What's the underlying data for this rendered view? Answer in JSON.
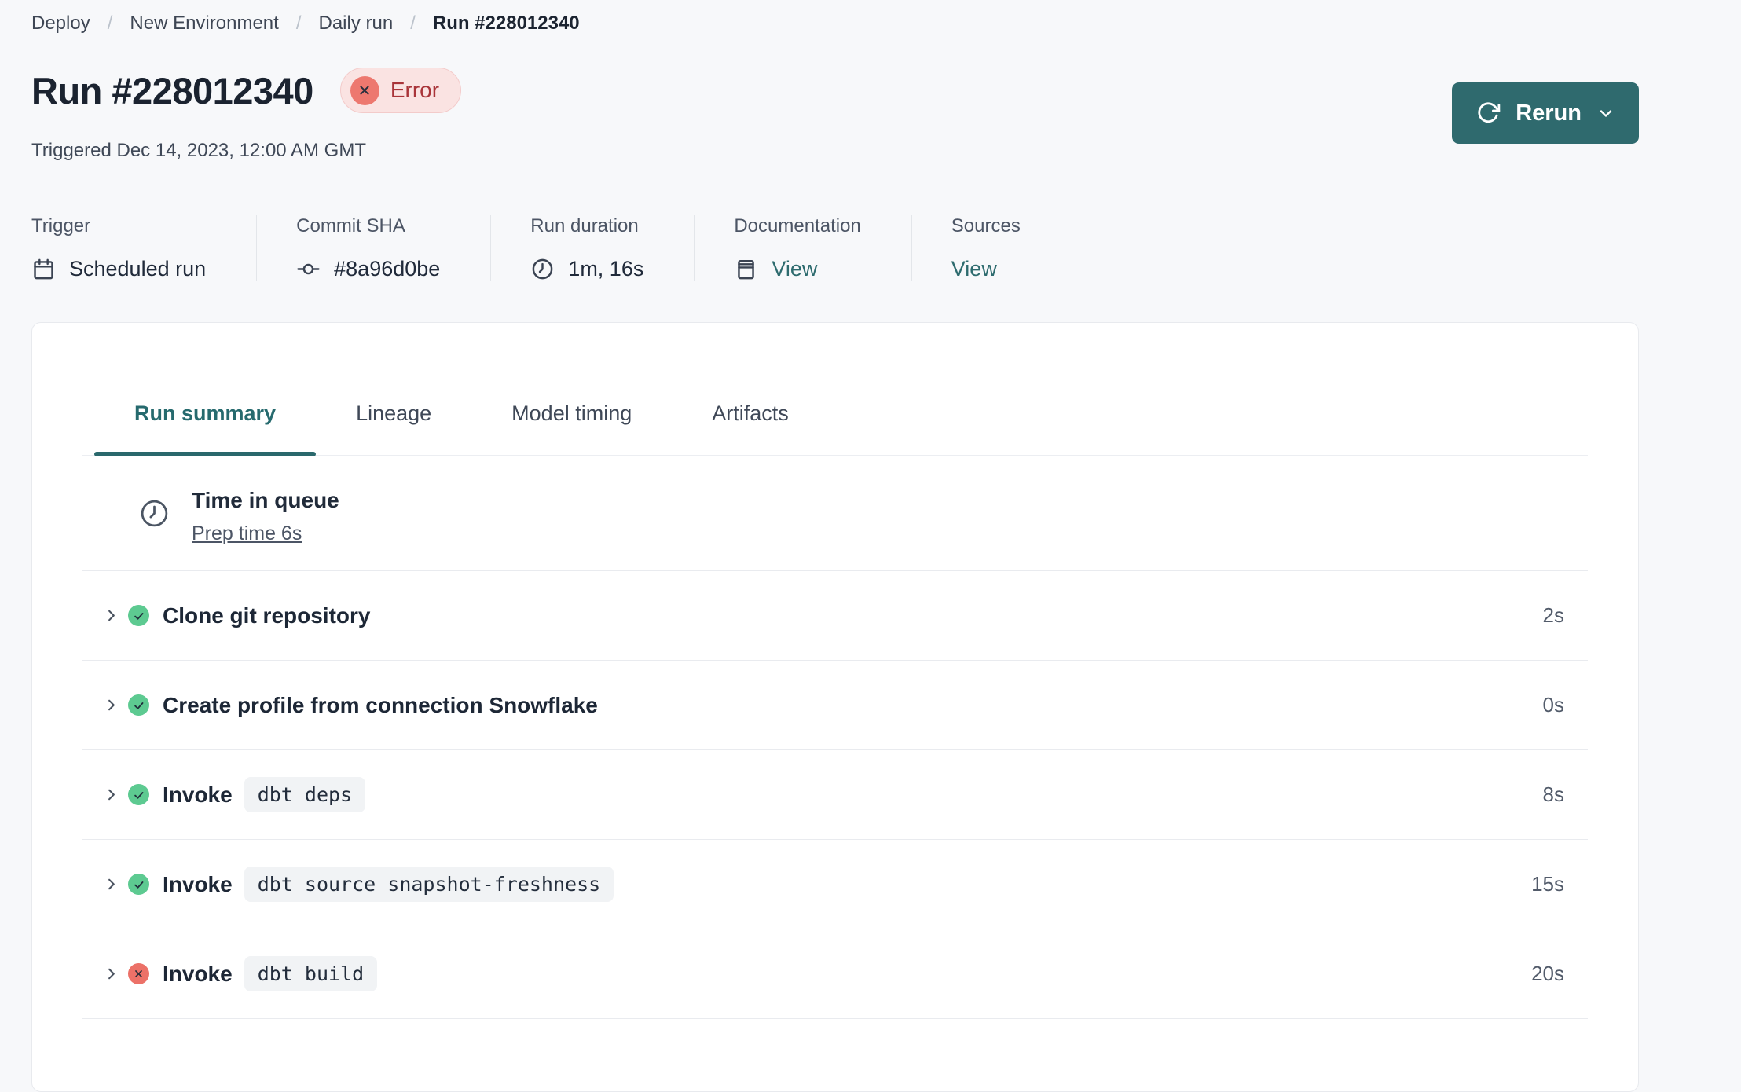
{
  "breadcrumb": {
    "separator": "/",
    "items": [
      {
        "label": "Deploy"
      },
      {
        "label": "New Environment"
      },
      {
        "label": "Daily run"
      },
      {
        "label": "Run #228012340"
      }
    ]
  },
  "header": {
    "title": "Run #228012340",
    "status_label": "Error",
    "status_icon": "x-circle-icon",
    "triggered": "Triggered Dec 14, 2023, 12:00 AM GMT",
    "rerun_label": "Rerun"
  },
  "meta": {
    "items": [
      {
        "label": "Trigger",
        "value": "Scheduled run",
        "icon": "calendar-icon"
      },
      {
        "label": "Commit SHA",
        "value": "#8a96d0be",
        "icon": "commit-icon"
      },
      {
        "label": "Run duration",
        "value": "1m, 16s",
        "icon": "clock-icon"
      },
      {
        "label": "Documentation",
        "value": "View",
        "icon": "book-icon",
        "link": true
      },
      {
        "label": "Sources",
        "value": "View",
        "link": true
      }
    ]
  },
  "tabs": [
    {
      "label": "Run summary",
      "active": true
    },
    {
      "label": "Lineage",
      "active": false
    },
    {
      "label": "Model timing",
      "active": false
    },
    {
      "label": "Artifacts",
      "active": false
    }
  ],
  "queue": {
    "title": "Time in queue",
    "link_label": "Prep time 6s",
    "icon": "clock-icon"
  },
  "steps": [
    {
      "label": "Clone git repository",
      "status": "success",
      "duration": "2s"
    },
    {
      "label": "Create profile from connection Snowflake",
      "status": "success",
      "duration": "0s"
    },
    {
      "label": "Invoke",
      "command": "dbt deps",
      "status": "success",
      "duration": "8s"
    },
    {
      "label": "Invoke",
      "command": "dbt source snapshot-freshness",
      "status": "success",
      "duration": "15s"
    },
    {
      "label": "Invoke",
      "command": "dbt build",
      "status": "error",
      "duration": "20s"
    }
  ],
  "colors": {
    "accent_teal": "#2F6A6E",
    "success_green": "#5DCA91",
    "error_red": "#EC7168",
    "error_badge_bg": "#FAE3E2",
    "error_badge_text": "#A93439",
    "page_bg": "#F7F8FA",
    "card_bg": "#FFFFFF",
    "text_dark": "#1C2431",
    "text_gray": "#4C5565",
    "divider": "#E9EBEF"
  }
}
